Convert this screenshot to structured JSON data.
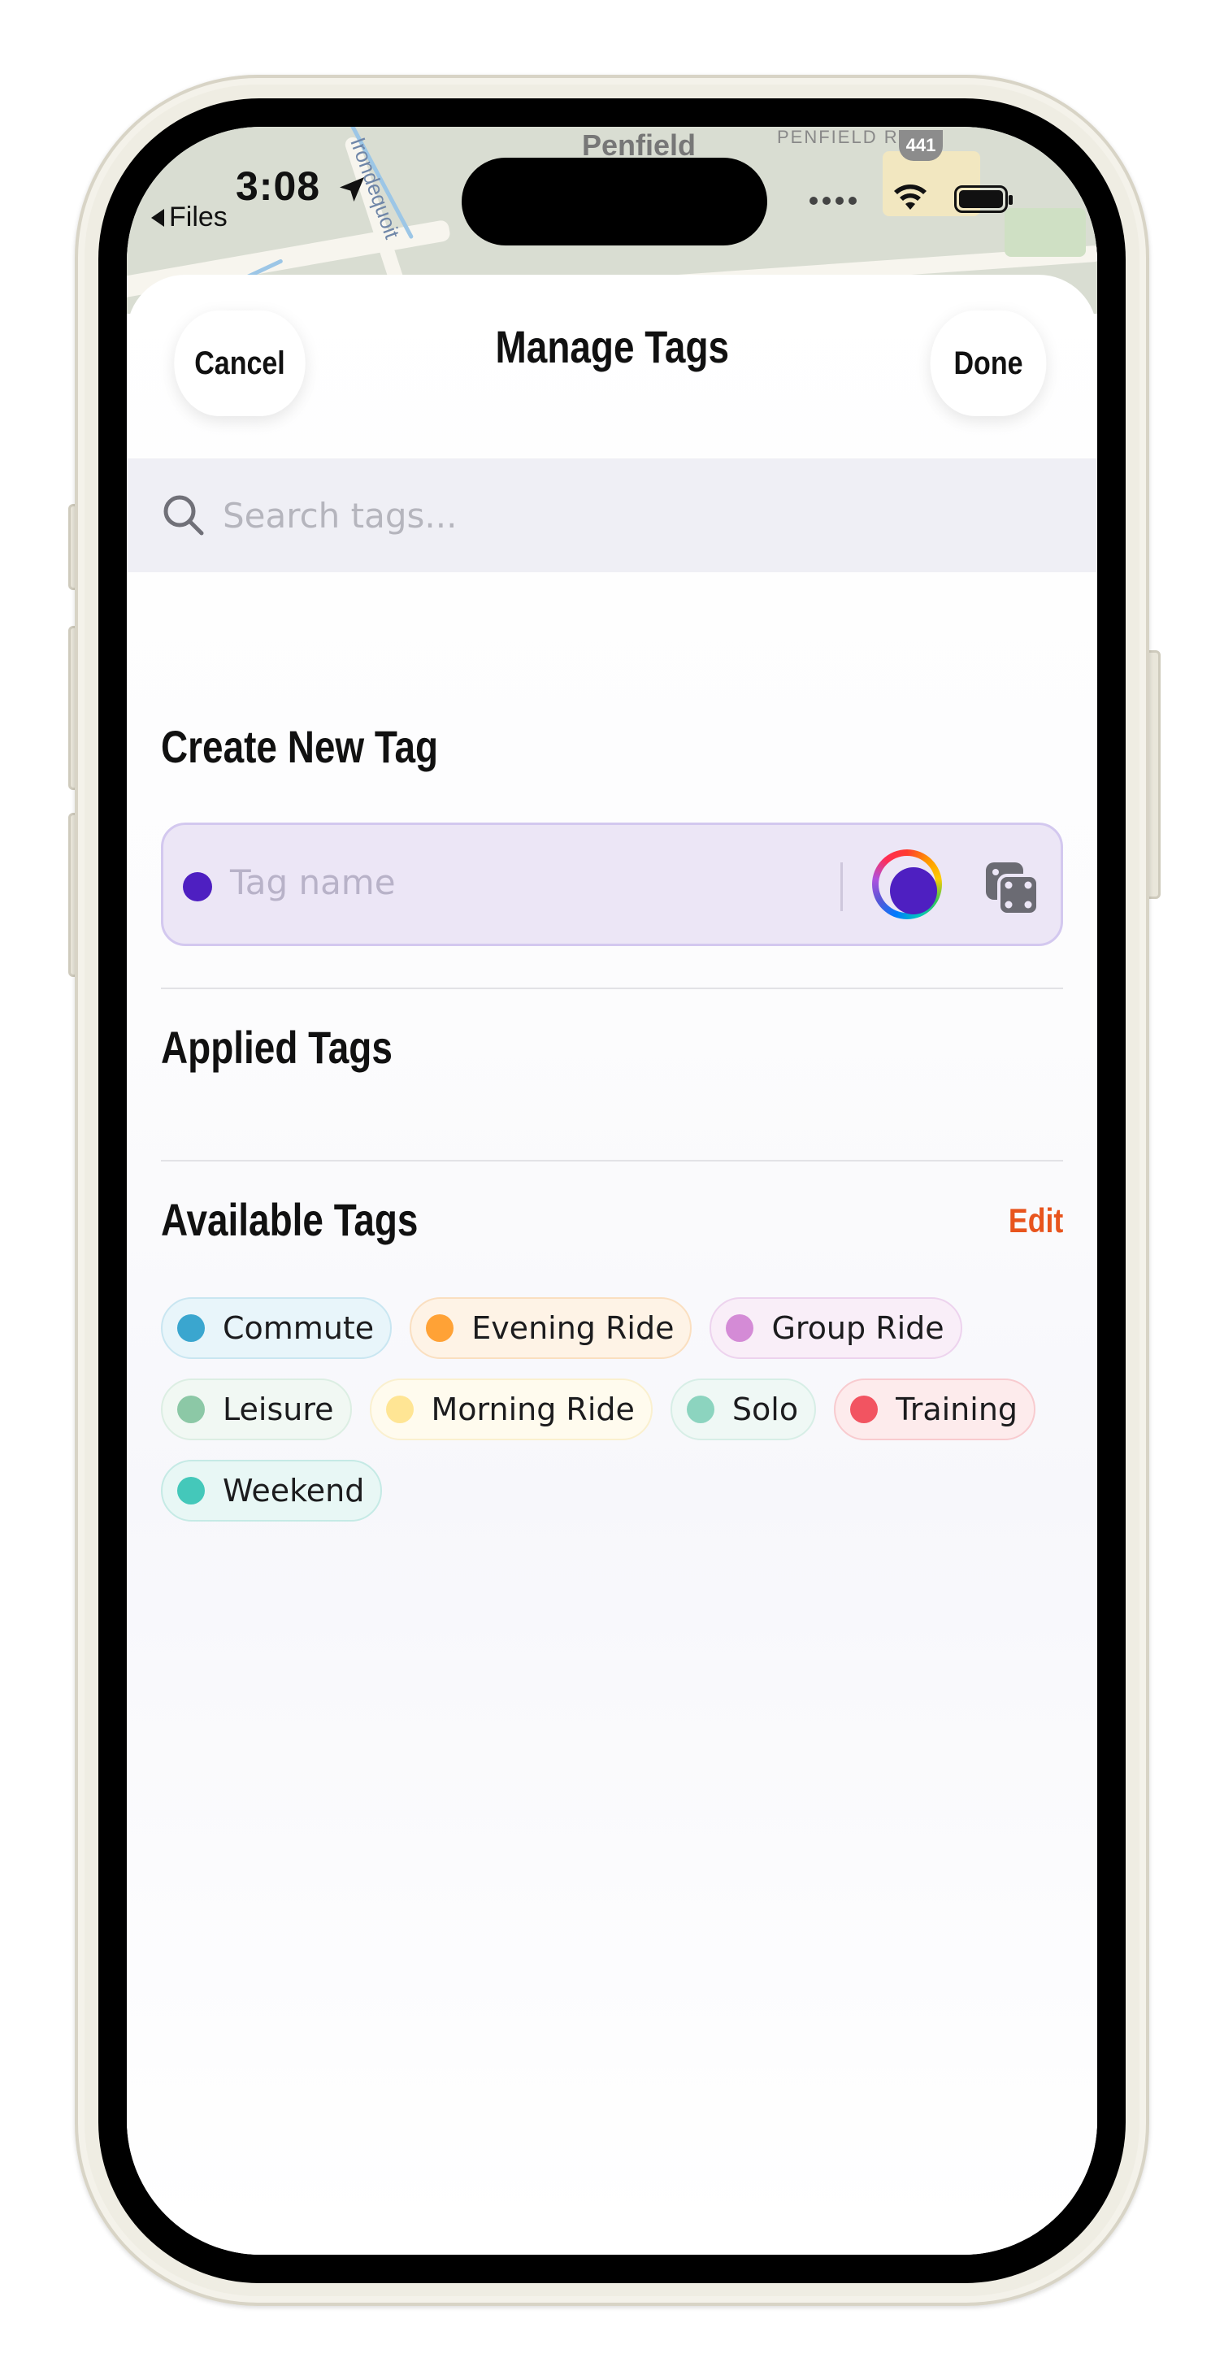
{
  "status_bar": {
    "time": "3:08",
    "back_app": "Files"
  },
  "map": {
    "place_label": "Penfield",
    "road_label": "PENFIELD RD",
    "route_shield": "441",
    "street_label": "Irondequoit"
  },
  "header": {
    "cancel_label": "Cancel",
    "title": "Manage Tags",
    "done_label": "Done"
  },
  "search": {
    "placeholder": "Search tags..."
  },
  "create_section": {
    "title": "Create New Tag",
    "input_placeholder": "Tag name",
    "selected_color": "#4E1FC1"
  },
  "applied_section": {
    "title": "Applied Tags"
  },
  "available_section": {
    "title": "Available Tags",
    "edit_label": "Edit",
    "tags": [
      {
        "label": "Commute",
        "color": "#3AA6CF",
        "bg": "#E8F5FA",
        "border": "#C9E6F1"
      },
      {
        "label": "Evening Ride",
        "color": "#FFA236",
        "bg": "#FEF3E6",
        "border": "#FADFC0"
      },
      {
        "label": "Group Ride",
        "color": "#D48BD6",
        "bg": "#F9EEF8",
        "border": "#EDD3EE"
      },
      {
        "label": "Leisure",
        "color": "#8CC8A6",
        "bg": "#F1F8F3",
        "border": "#DCEEE3"
      },
      {
        "label": "Morning Ride",
        "color": "#FFE594",
        "bg": "#FFFBEE",
        "border": "#FAF0CF"
      },
      {
        "label": "Solo",
        "color": "#8CD4BF",
        "bg": "#EFF8F5",
        "border": "#D7EEE6"
      },
      {
        "label": "Training",
        "color": "#F25461",
        "bg": "#FDEBEC",
        "border": "#F8CBCF"
      },
      {
        "label": "Weekend",
        "color": "#44C8BA",
        "bg": "#E8F7F5",
        "border": "#C5EAE5"
      }
    ]
  },
  "colors": {
    "accent": "#E8541D",
    "tag_color": "#4E1FC1"
  }
}
